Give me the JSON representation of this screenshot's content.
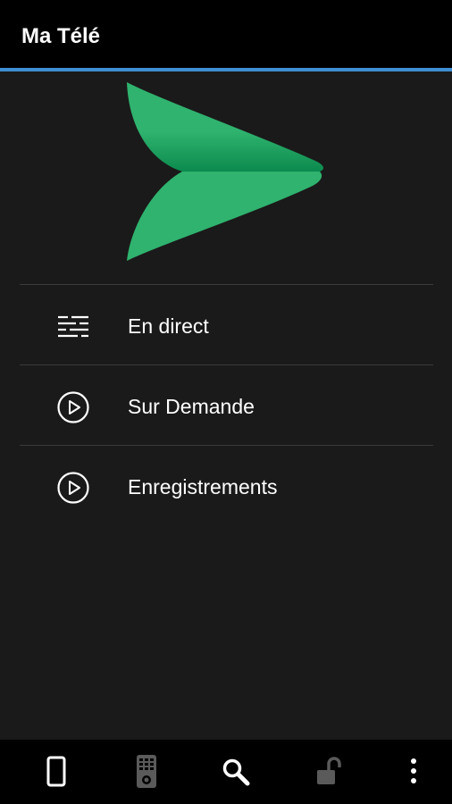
{
  "header": {
    "title": "Ma Télé"
  },
  "colors": {
    "accent": "#3f8fd4",
    "brand_green": "#2fb36e",
    "brand_green_dark": "#0c8a4e",
    "background": "#1a1a1a",
    "bar": "#000000",
    "divider": "#3a3a3a",
    "icon_active": "#ffffff",
    "icon_inactive": "#5a5a5a"
  },
  "logo": {
    "icon": "green-arrow-logo"
  },
  "menu": {
    "items": [
      {
        "label": "En direct",
        "icon": "live-guide-icon"
      },
      {
        "label": "Sur Demande",
        "icon": "play-circle-icon"
      },
      {
        "label": "Enregistrements",
        "icon": "play-circle-icon"
      }
    ]
  },
  "bottom_nav": {
    "items": [
      {
        "icon": "phone-icon",
        "state": "active"
      },
      {
        "icon": "remote-icon",
        "state": "inactive"
      },
      {
        "icon": "search-icon",
        "state": "active"
      },
      {
        "icon": "unlock-icon",
        "state": "inactive"
      },
      {
        "icon": "more-vert-icon",
        "state": "active"
      }
    ]
  }
}
